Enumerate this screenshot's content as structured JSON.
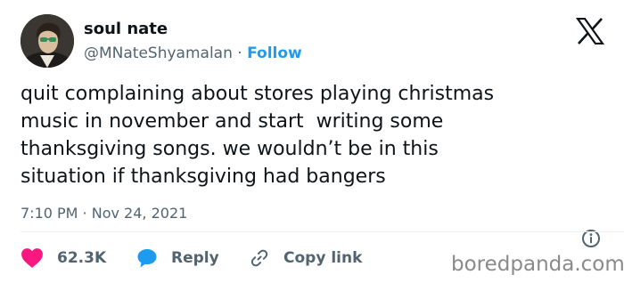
{
  "author": {
    "display_name": "soul nate",
    "handle": "@MNateShyamalan",
    "separator": " · ",
    "follow_label": "Follow"
  },
  "tweet": {
    "text": "quit complaining about stores playing christmas\nmusic in november and start  writing some\nthanksgiving songs. we wouldn’t be in this\nsituation if thanksgiving had bangers",
    "time": "7:10 PM",
    "date_separator": " · ",
    "date": "Nov 24, 2021"
  },
  "actions": {
    "likes": "62.3K",
    "reply_label": "Reply",
    "copy_label": "Copy link"
  },
  "watermark": "boredpanda.com",
  "colors": {
    "text": "#0f1419",
    "secondary": "#536471",
    "accent": "#1d9bf0",
    "like": "#f91880",
    "reply": "#1d9bf0"
  },
  "icons": {
    "platform_logo": "x-logo-icon",
    "info": "info-icon",
    "like": "heart-icon",
    "reply": "speech-bubble-icon",
    "copy": "link-icon"
  }
}
